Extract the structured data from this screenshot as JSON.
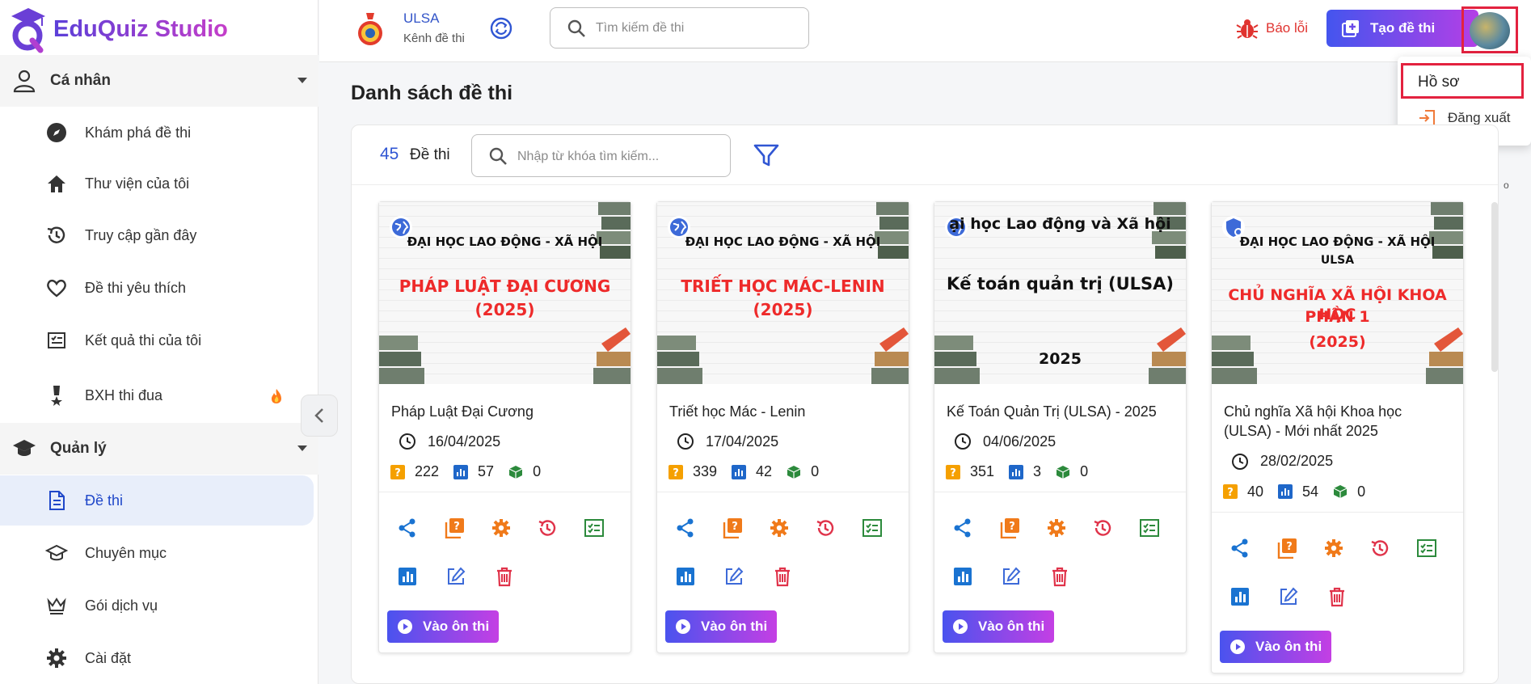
{
  "app": {
    "name": "EduQuiz Studio"
  },
  "sidebar": {
    "personal": {
      "label": "Cá nhân"
    },
    "personal_items": [
      {
        "label": "Khám phá đề thi",
        "icon": "compass-icon"
      },
      {
        "label": "Thư viện của tôi",
        "icon": "home-icon"
      },
      {
        "label": "Truy cập gần đây",
        "icon": "history-icon"
      },
      {
        "label": "Đề thi yêu thích",
        "icon": "heart-icon"
      },
      {
        "label": "Kết quả thi của tôi",
        "icon": "result-icon"
      },
      {
        "label": "BXH thi đua",
        "icon": "medal-icon"
      }
    ],
    "manage": {
      "label": "Quản lý"
    },
    "manage_items": [
      {
        "label": "Đề thi",
        "icon": "document-icon",
        "active": true
      },
      {
        "label": "Chuyên mục",
        "icon": "category-icon"
      },
      {
        "label": "Gói dịch vụ",
        "icon": "crown-icon"
      },
      {
        "label": "Cài đặt",
        "icon": "gear-icon"
      }
    ]
  },
  "topbar": {
    "channel_name": "ULSA",
    "channel_sub": "Kênh đề thi",
    "search_placeholder": "Tìm kiếm đề thi",
    "report_label": "Báo lỗi",
    "create_label": "Tạo đề thi"
  },
  "user_menu": {
    "profile": "Hồ sơ",
    "logout": "Đăng xuất"
  },
  "page": {
    "title": "Danh sách đề thi",
    "count": "45",
    "count_label": "Đề thi",
    "search_placeholder": "Nhập từ khóa tìm kiếm..."
  },
  "colors": {
    "accent": "#3056d3",
    "danger": "#e3223f",
    "gradient_start": "#4455ee",
    "gradient_end": "#b43fe6"
  },
  "cards": [
    {
      "thumb_school": "ĐẠI HỌC LAO ĐỘNG - XÃ HỘI",
      "thumb_main": "PHÁP LUẬT ĐẠI CƯƠNG",
      "thumb_year": "(2025)",
      "title": "Pháp Luật Đại Cương",
      "date": "16/04/2025",
      "questions": "222",
      "attempts": "57",
      "likes": "0",
      "start_label": "Vào ôn thi"
    },
    {
      "thumb_school": "ĐẠI HỌC LAO ĐỘNG - XÃ HỘI",
      "thumb_main": "TRIẾT HỌC MÁC-LENIN",
      "thumb_year": "(2025)",
      "title": "Triết học Mác - Lenin",
      "date": "17/04/2025",
      "questions": "339",
      "attempts": "42",
      "likes": "0",
      "start_label": "Vào ôn thi"
    },
    {
      "thumb_school": "ại học Lao động và Xã hội",
      "thumb_main": "Kế toán quản trị (ULSA)",
      "thumb_year": "2025",
      "title": "Kế Toán Quản Trị (ULSA) - 2025",
      "date": "04/06/2025",
      "questions": "351",
      "attempts": "3",
      "likes": "0",
      "start_label": "Vào ôn thi"
    },
    {
      "thumb_school": "ĐẠI HỌC LAO ĐỘNG - XÃ HỘI",
      "thumb_school2": "ULSA",
      "thumb_main": "CHỦ NGHĨA XÃ HỘI KHOA HỌC",
      "thumb_main2": "PHẦN 1",
      "thumb_year": "(2025)",
      "title": "Chủ nghĩa Xã hội Khoa học (ULSA) - Mới nhất 2025",
      "date": "28/02/2025",
      "questions": "40",
      "attempts": "54",
      "likes": "0",
      "start_label": "Vào ôn thi"
    }
  ]
}
